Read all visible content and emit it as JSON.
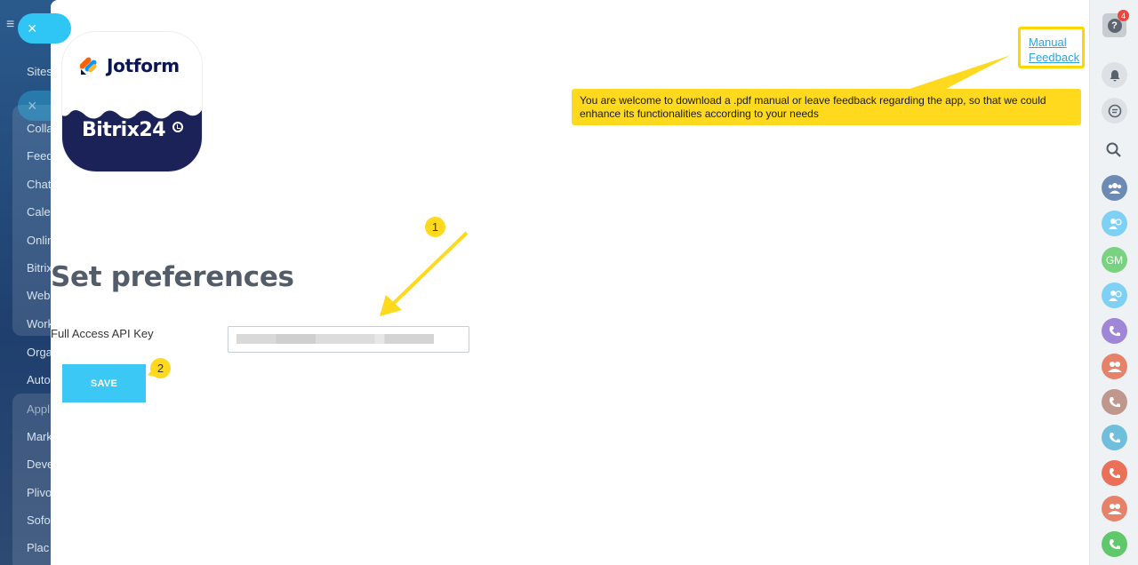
{
  "sidebar": {
    "items": [
      "Sites",
      "Colla",
      "Feed",
      "Chat",
      "Cale",
      "Onlin",
      "Bitrix",
      "Web",
      "Work",
      "Orga",
      "Auto",
      "Appl",
      "Mark",
      "Deve",
      "Plivo",
      "Sofo",
      "Plac"
    ]
  },
  "close_icon": "×",
  "logo": {
    "jotform": "Jotform",
    "bitrix": "Bitrix24"
  },
  "page": {
    "title": "Set preferences",
    "api_label": "Full Access API Key",
    "save_label": "SAVE"
  },
  "links": {
    "manual": "Manual",
    "feedback": "Feedback"
  },
  "callout": {
    "text": "You are welcome to download a .pdf manual or leave feedback regarding the app, so that we could enhance its functionalities according to your needs"
  },
  "steps": {
    "one": "1",
    "two": "2"
  },
  "right_bar": {
    "help_glyph": "?",
    "notification_count": "4",
    "gm_initials": "GM"
  },
  "colors": {
    "accent": "#3bc8f5",
    "callout": "#ffd91e",
    "title": "#535c69"
  }
}
